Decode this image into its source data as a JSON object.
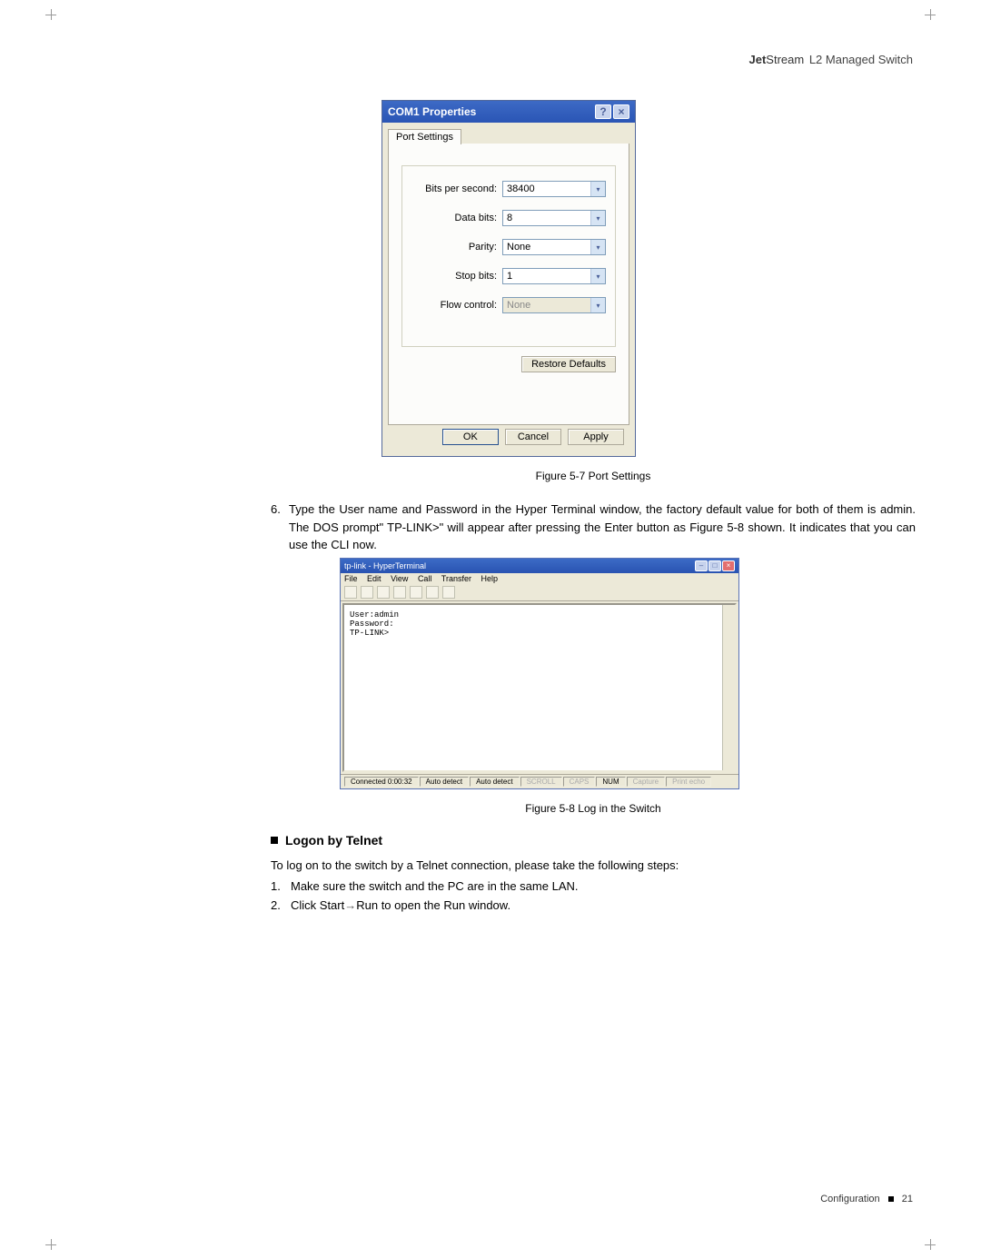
{
  "header": {
    "brand_prefix": "Jet",
    "brand_suffix": "Stream",
    "product": "L2 Managed Switch"
  },
  "dialog1": {
    "title": "COM1 Properties",
    "tab": "Port Settings",
    "fields": {
      "bps": {
        "label": "Bits per second:",
        "value": "38400"
      },
      "databits": {
        "label": "Data bits:",
        "value": "8"
      },
      "parity": {
        "label": "Parity:",
        "value": "None"
      },
      "stopbits": {
        "label": "Stop bits:",
        "value": "1"
      },
      "flow": {
        "label": "Flow control:",
        "value": "None"
      }
    },
    "restore": "Restore Defaults",
    "ok": "OK",
    "cancel": "Cancel",
    "apply": "Apply"
  },
  "caption1": "Figure 5-7  Port Settings",
  "step6": {
    "num": "6.",
    "text": "Type the User name and Password in the Hyper Terminal window, the factory default value for both of them is admin. The DOS prompt\" TP-LINK>\" will appear after pressing the Enter button as Figure 5-8 shown. It indicates that you can use the CLI now."
  },
  "hyper": {
    "title": "tp-link - HyperTerminal",
    "menu": [
      "File",
      "Edit",
      "View",
      "Call",
      "Transfer",
      "Help"
    ],
    "termlines": [
      "User:admin",
      "Password:",
      "TP-LINK>"
    ],
    "status": {
      "connected": "Connected 0:00:32",
      "detect1": "Auto detect",
      "detect2": "Auto detect",
      "scroll": "SCROLL",
      "caps": "CAPS",
      "num": "NUM",
      "capture": "Capture",
      "echo": "Print echo"
    }
  },
  "caption2": "Figure 5-8  Log in the Switch",
  "section": "Logon by Telnet",
  "telnet_intro": "To log on to the switch by a Telnet connection, please take the following steps:",
  "telnet_steps": [
    {
      "num": "1.",
      "text": "Make sure the switch and the PC are in the same LAN."
    },
    {
      "num": "2.",
      "text_a": "Click Start",
      "arrow": "→",
      "text_b": "Run to open the Run window."
    }
  ],
  "footer": {
    "section": "Configuration",
    "page": "21"
  }
}
